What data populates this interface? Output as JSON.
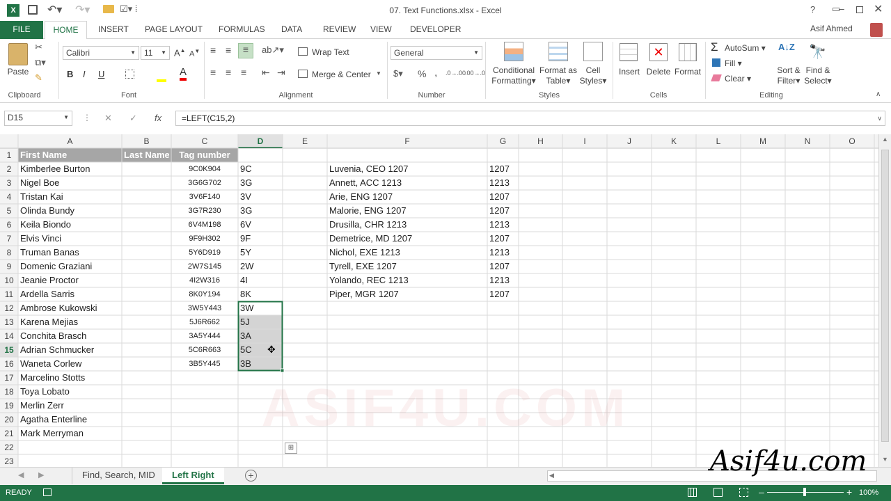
{
  "window": {
    "title": "07. Text Functions.xlsx - Excel",
    "user": "Asif Ahmed"
  },
  "ribbon_tabs": [
    "FILE",
    "HOME",
    "INSERT",
    "PAGE LAYOUT",
    "FORMULAS",
    "DATA",
    "REVIEW",
    "VIEW",
    "DEVELOPER"
  ],
  "clipboard": {
    "paste": "Paste",
    "label": "Clipboard"
  },
  "font": {
    "name": "Calibri",
    "size": "11",
    "bold": "B",
    "italic": "I",
    "underline": "U",
    "label": "Font"
  },
  "alignment": {
    "wrap": "Wrap Text",
    "merge": "Merge & Center",
    "label": "Alignment"
  },
  "number": {
    "format": "General",
    "label": "Number"
  },
  "styles": {
    "cond1": "Conditional",
    "cond2": "Formatting",
    "fmt1": "Format as",
    "fmt2": "Table",
    "cell1": "Cell",
    "cell2": "Styles",
    "label": "Styles"
  },
  "cells": {
    "insert": "Insert",
    "delete": "Delete",
    "format": "Format",
    "label": "Cells"
  },
  "editing": {
    "autosum": "AutoSum",
    "fill": "Fill",
    "clear": "Clear",
    "sort1": "Sort &",
    "sort2": "Filter",
    "find1": "Find &",
    "find2": "Select",
    "label": "Editing"
  },
  "formula_bar": {
    "name_box": "D15",
    "fx": "fx",
    "formula": "=LEFT(C15,2)"
  },
  "columns": [
    "A",
    "B",
    "C",
    "D",
    "E",
    "F",
    "G",
    "H",
    "I",
    "J",
    "K",
    "L",
    "M",
    "N",
    "O"
  ],
  "rows": [
    "1",
    "2",
    "3",
    "4",
    "5",
    "6",
    "7",
    "8",
    "9",
    "10",
    "11",
    "12",
    "13",
    "14",
    "15",
    "16",
    "17",
    "18",
    "19",
    "20",
    "21",
    "22",
    "23"
  ],
  "header_row": {
    "a": "First Name",
    "b": "Last Name",
    "c": "Tag number"
  },
  "col_a": [
    "Kimberlee Burton",
    "Nigel Boe",
    "Tristan Kai",
    "Olinda Bundy",
    "Keila Biondo",
    "Elvis Vinci",
    "Truman Banas",
    "Domenic Graziani",
    "Jeanie Proctor",
    "Ardella Sarris",
    "Ambrose Kukowski",
    "Karena Mejias",
    "Conchita Brasch",
    "Adrian Schmucker",
    "Waneta Corlew",
    "Marcelino Stotts",
    "Toya Lobato",
    "Merlin Zerr",
    "Agatha Enterline",
    "Mark Merryman"
  ],
  "col_c": [
    "9C0K904",
    "3G6G702",
    "3V6F140",
    "3G7R230",
    "6V4M198",
    "9F9H302",
    "5Y6D919",
    "2W7S145",
    "4I2W316",
    "8K0Y194",
    "3W5Y443",
    "5J6R662",
    "3A5Y444",
    "5C6R663",
    "3B5Y445"
  ],
  "col_d": [
    "9C",
    "3G",
    "3V",
    "3G",
    "6V",
    "9F",
    "5Y",
    "2W",
    "4I",
    "8K",
    "3W",
    "5J",
    "3A",
    "5C",
    "3B"
  ],
  "col_f": [
    "Luvenia, CEO 1207",
    "Annett, ACC 1213",
    "Arie, ENG 1207",
    "Malorie, ENG 1207",
    "Drusilla, CHR 1213",
    "Demetrice, MD 1207",
    "Nichol, EXE 1213",
    "Tyrell, EXE 1207",
    "Yolando, REC 1213",
    "Piper, MGR 1207"
  ],
  "col_g": [
    "1207",
    "1213",
    "1207",
    "1207",
    "1213",
    "1207",
    "1213",
    "1207",
    "1213",
    "1207"
  ],
  "sheets": [
    "Find, Search, MID",
    "Left Right"
  ],
  "status": {
    "ready": "READY",
    "zoom": "100%"
  },
  "watermark": "Asif4u.com",
  "colors": {
    "excel_green": "#217346",
    "header_fill": "#a6a6a6",
    "selection": "#d4d4d4"
  }
}
